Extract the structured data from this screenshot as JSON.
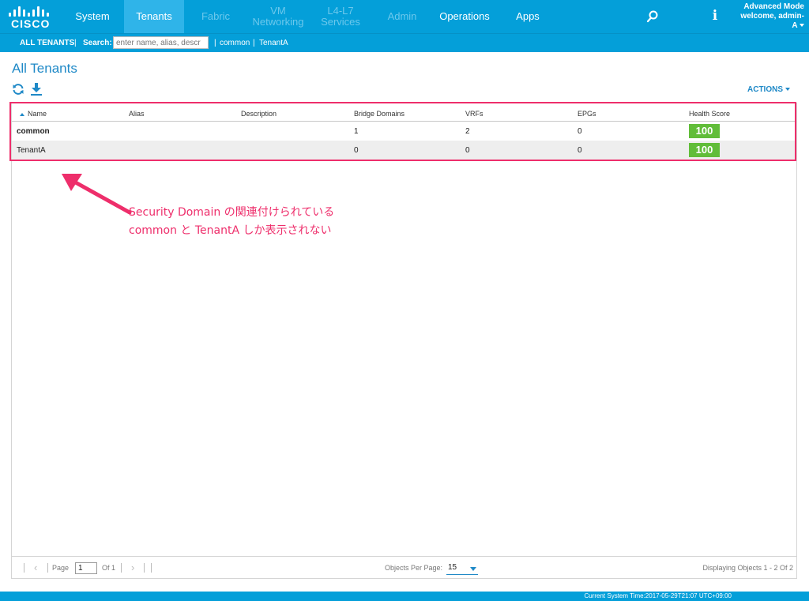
{
  "brand": {
    "logo_text": "CISCO"
  },
  "nav": {
    "tabs": [
      {
        "label": "System",
        "state": "normal"
      },
      {
        "label": "Tenants",
        "state": "active"
      },
      {
        "label": "Fabric",
        "state": "disabled"
      },
      {
        "label_line1": "VM",
        "label_line2": "Networking",
        "state": "disabled"
      },
      {
        "label_line1": "L4-L7",
        "label_line2": "Services",
        "state": "disabled"
      },
      {
        "label": "Admin",
        "state": "disabled"
      },
      {
        "label": "Operations",
        "state": "normal"
      },
      {
        "label": "Apps",
        "state": "normal"
      }
    ],
    "search_icon": "search-icon",
    "info_icon": "i",
    "account": {
      "mode": "Advanced Mode",
      "welcome": "welcome, admin-",
      "user_suffix": "A"
    }
  },
  "subnav": {
    "all_tenants": "ALL TENANTS",
    "sep1": "|",
    "search_label": "Search:",
    "search_placeholder": "enter name, alias, descr",
    "sep2": "|",
    "link_common": "common",
    "sep3": "|",
    "link_tenanta": "TenantA"
  },
  "page": {
    "title": "All Tenants",
    "actions_label": "ACTIONS"
  },
  "table": {
    "columns": [
      "Name",
      "Alias",
      "Description",
      "Bridge Domains",
      "VRFs",
      "EPGs",
      "Health Score"
    ],
    "rows": [
      {
        "name": "common",
        "alias": "",
        "description": "",
        "bridge_domains": "1",
        "vrfs": "2",
        "epgs": "0",
        "health": "100"
      },
      {
        "name": "TenantA",
        "alias": "",
        "description": "",
        "bridge_domains": "0",
        "vrfs": "0",
        "epgs": "0",
        "health": "100"
      }
    ]
  },
  "annotation": {
    "line1": "Security Domain の関連付けられている",
    "line2": "common と TenantA しか表示されない",
    "color": "#ee2e6b"
  },
  "pager": {
    "page_label": "Page",
    "page_value": "1",
    "of_label": "Of 1",
    "per_page_label": "Objects Per Page:",
    "per_page_value": "15",
    "displaying": "Displaying Objects 1 - 2 Of 2"
  },
  "status": {
    "system_time": "Current System Time:2017-05-29T21:07 UTC+09:00"
  },
  "colors": {
    "nav_bg": "#049fd9",
    "nav_active": "#2fb4e9",
    "accent": "#1f89c7",
    "health_good": "#61bd39",
    "highlight": "#ee2e6b"
  }
}
